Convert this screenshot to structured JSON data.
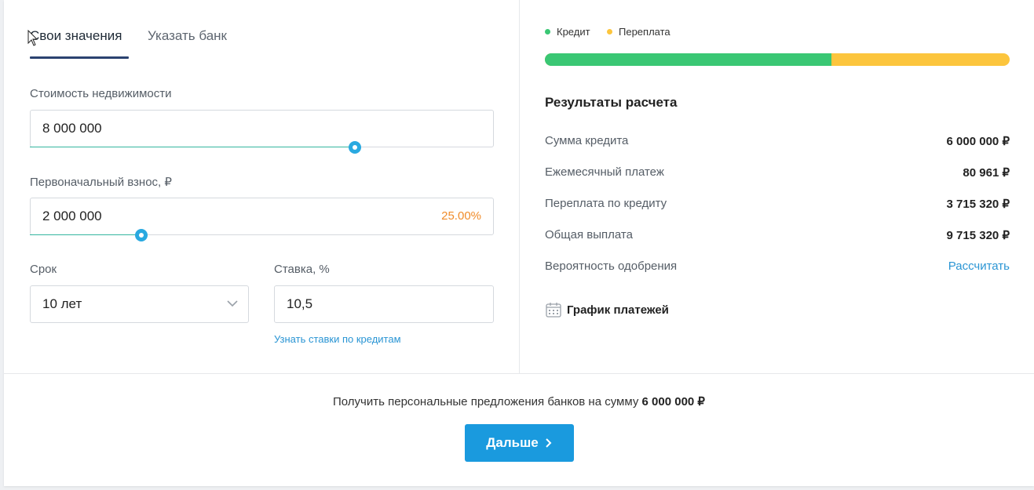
{
  "tabs": {
    "own_values": "Свои значения",
    "choose_bank": "Указать банк"
  },
  "form": {
    "property_cost": {
      "label": "Стоимость недвижимости",
      "value": "8 000 000",
      "slider_fraction": 0.7
    },
    "down_payment": {
      "label": "Первоначальный взнос, ₽",
      "value": "2 000 000",
      "percent": "25.00%",
      "slider_fraction": 0.24
    },
    "term": {
      "label": "Срок",
      "value": "10 лет"
    },
    "rate": {
      "label": "Ставка, %",
      "value": "10,5",
      "link": "Узнать ставки по кредитам"
    }
  },
  "legend": {
    "credit": "Кредит",
    "overpay": "Переплата",
    "credit_color": "#3ac774",
    "overpay_color": "#fcc53d",
    "credit_fraction": 0.617
  },
  "results": {
    "title": "Результаты расчета",
    "rows": [
      {
        "label": "Сумма кредита",
        "value": "6 000 000 ₽"
      },
      {
        "label": "Ежемесячный платеж",
        "value": "80 961 ₽"
      },
      {
        "label": "Переплата по кредиту",
        "value": "3 715 320 ₽"
      },
      {
        "label": "Общая выплата",
        "value": "9 715 320 ₽"
      }
    ],
    "approval_label": "Вероятность одобрения",
    "approval_link": "Рассчитать",
    "schedule": "График платежей"
  },
  "footer": {
    "offer_text": "Получить персональные предложения банков на сумму",
    "offer_amount": "6 000 000 ₽",
    "next_button": "Дальше"
  }
}
